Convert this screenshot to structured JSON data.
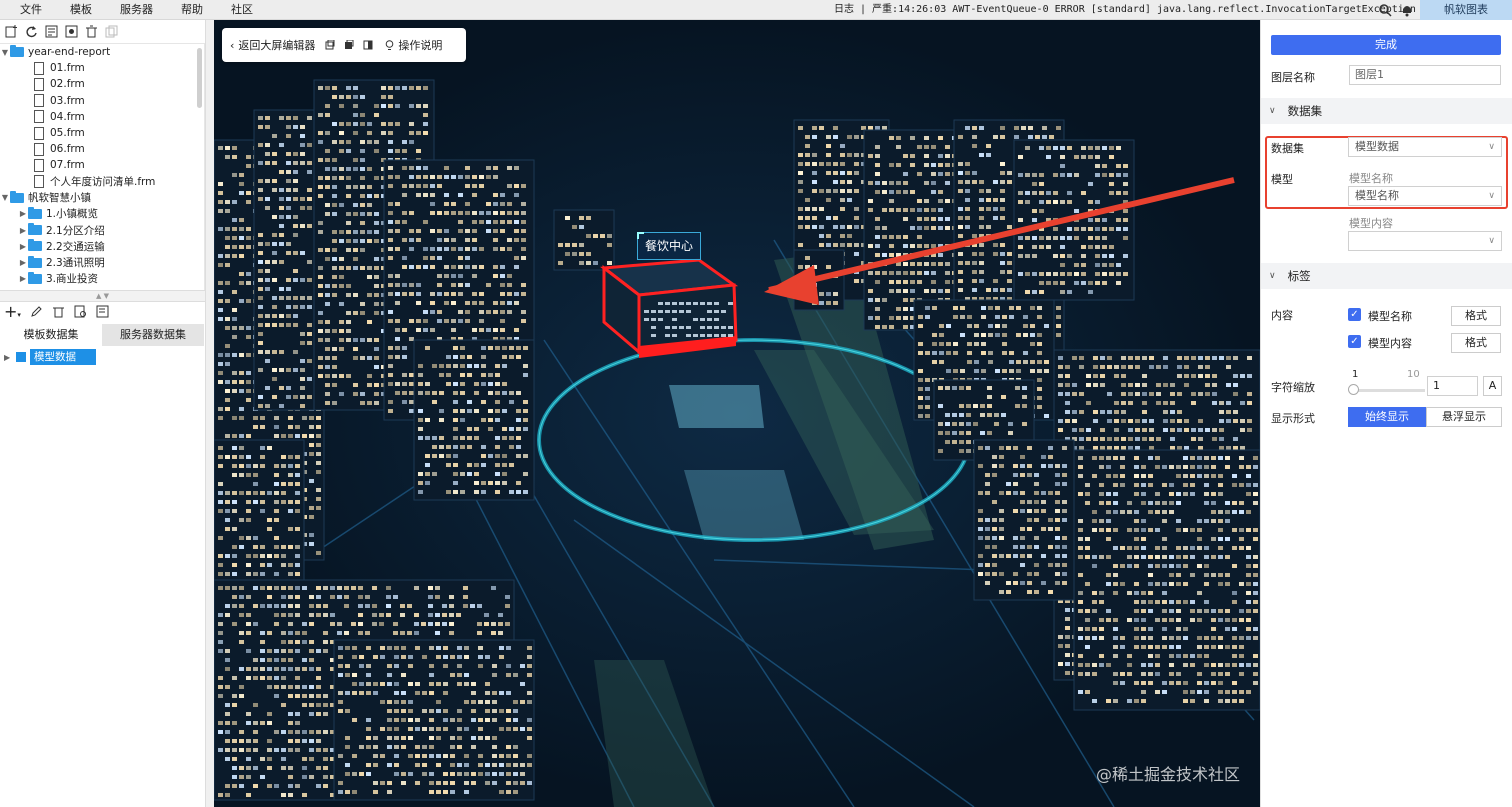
{
  "menubar": {
    "items": [
      "文件",
      "模板",
      "服务器",
      "帮助",
      "社区"
    ],
    "log": "日志 | 严重:14:26:03 AWT-EventQueue-0 ERROR [standard] java.lang.reflect.InvocationTargetException",
    "brand": "帆软图表"
  },
  "tree": {
    "root1": "year-end-report",
    "files": [
      "01.frm",
      "02.frm",
      "03.frm",
      "04.frm",
      "05.frm",
      "06.frm",
      "07.frm",
      "个人年度访问清单.frm"
    ],
    "root2": "帆软智慧小镇",
    "folders": [
      "1.小镇概览",
      "2.1分区介绍",
      "2.2交通运输",
      "2.3通讯照明",
      "3.商业投资"
    ]
  },
  "datasets": {
    "tabs": [
      "模板数据集",
      "服务器数据集"
    ],
    "item": "模型数据"
  },
  "scene": {
    "toolbar": {
      "back": "返回大屏编辑器",
      "help": "操作说明"
    },
    "building_label": "餐饮中心",
    "watermark": "@稀土掘金技术社区"
  },
  "panel": {
    "done": "完成",
    "layer_name_label": "图层名称",
    "layer_name_value": "图层1",
    "section_dataset": "数据集",
    "dataset_label": "数据集",
    "dataset_value": "模型数据",
    "model_label": "模型",
    "model_name_caption": "模型名称",
    "model_name_value": "模型名称",
    "model_content_caption": "模型内容",
    "model_content_value": "",
    "section_label": "标签",
    "content_label": "内容",
    "check1": "模型名称",
    "check2": "模型内容",
    "format_btn": "格式",
    "font_scale_label": "字符缩放",
    "scale_min": "1",
    "scale_max": "10",
    "scale_value": "1",
    "a_btn": "A",
    "display_label": "显示形式",
    "display_options": [
      "始终显示",
      "悬浮显示"
    ]
  },
  "colors": {
    "accent": "#3e6df0",
    "highlight": "#e8412f",
    "scene_bg": "#061422"
  }
}
